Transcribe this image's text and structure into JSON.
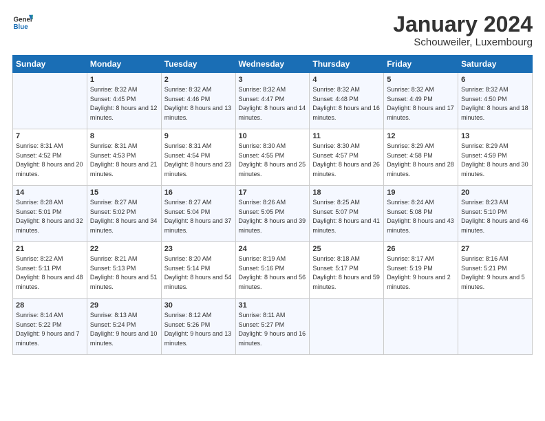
{
  "header": {
    "logo_general": "General",
    "logo_blue": "Blue",
    "month_title": "January 2024",
    "location": "Schouweiler, Luxembourg"
  },
  "calendar": {
    "days_of_week": [
      "Sunday",
      "Monday",
      "Tuesday",
      "Wednesday",
      "Thursday",
      "Friday",
      "Saturday"
    ],
    "weeks": [
      [
        {
          "day": "",
          "sunrise": "",
          "sunset": "",
          "daylight": ""
        },
        {
          "day": "1",
          "sunrise": "Sunrise: 8:32 AM",
          "sunset": "Sunset: 4:45 PM",
          "daylight": "Daylight: 8 hours and 12 minutes."
        },
        {
          "day": "2",
          "sunrise": "Sunrise: 8:32 AM",
          "sunset": "Sunset: 4:46 PM",
          "daylight": "Daylight: 8 hours and 13 minutes."
        },
        {
          "day": "3",
          "sunrise": "Sunrise: 8:32 AM",
          "sunset": "Sunset: 4:47 PM",
          "daylight": "Daylight: 8 hours and 14 minutes."
        },
        {
          "day": "4",
          "sunrise": "Sunrise: 8:32 AM",
          "sunset": "Sunset: 4:48 PM",
          "daylight": "Daylight: 8 hours and 16 minutes."
        },
        {
          "day": "5",
          "sunrise": "Sunrise: 8:32 AM",
          "sunset": "Sunset: 4:49 PM",
          "daylight": "Daylight: 8 hours and 17 minutes."
        },
        {
          "day": "6",
          "sunrise": "Sunrise: 8:32 AM",
          "sunset": "Sunset: 4:50 PM",
          "daylight": "Daylight: 8 hours and 18 minutes."
        }
      ],
      [
        {
          "day": "7",
          "sunrise": "Sunrise: 8:31 AM",
          "sunset": "Sunset: 4:52 PM",
          "daylight": "Daylight: 8 hours and 20 minutes."
        },
        {
          "day": "8",
          "sunrise": "Sunrise: 8:31 AM",
          "sunset": "Sunset: 4:53 PM",
          "daylight": "Daylight: 8 hours and 21 minutes."
        },
        {
          "day": "9",
          "sunrise": "Sunrise: 8:31 AM",
          "sunset": "Sunset: 4:54 PM",
          "daylight": "Daylight: 8 hours and 23 minutes."
        },
        {
          "day": "10",
          "sunrise": "Sunrise: 8:30 AM",
          "sunset": "Sunset: 4:55 PM",
          "daylight": "Daylight: 8 hours and 25 minutes."
        },
        {
          "day": "11",
          "sunrise": "Sunrise: 8:30 AM",
          "sunset": "Sunset: 4:57 PM",
          "daylight": "Daylight: 8 hours and 26 minutes."
        },
        {
          "day": "12",
          "sunrise": "Sunrise: 8:29 AM",
          "sunset": "Sunset: 4:58 PM",
          "daylight": "Daylight: 8 hours and 28 minutes."
        },
        {
          "day": "13",
          "sunrise": "Sunrise: 8:29 AM",
          "sunset": "Sunset: 4:59 PM",
          "daylight": "Daylight: 8 hours and 30 minutes."
        }
      ],
      [
        {
          "day": "14",
          "sunrise": "Sunrise: 8:28 AM",
          "sunset": "Sunset: 5:01 PM",
          "daylight": "Daylight: 8 hours and 32 minutes."
        },
        {
          "day": "15",
          "sunrise": "Sunrise: 8:27 AM",
          "sunset": "Sunset: 5:02 PM",
          "daylight": "Daylight: 8 hours and 34 minutes."
        },
        {
          "day": "16",
          "sunrise": "Sunrise: 8:27 AM",
          "sunset": "Sunset: 5:04 PM",
          "daylight": "Daylight: 8 hours and 37 minutes."
        },
        {
          "day": "17",
          "sunrise": "Sunrise: 8:26 AM",
          "sunset": "Sunset: 5:05 PM",
          "daylight": "Daylight: 8 hours and 39 minutes."
        },
        {
          "day": "18",
          "sunrise": "Sunrise: 8:25 AM",
          "sunset": "Sunset: 5:07 PM",
          "daylight": "Daylight: 8 hours and 41 minutes."
        },
        {
          "day": "19",
          "sunrise": "Sunrise: 8:24 AM",
          "sunset": "Sunset: 5:08 PM",
          "daylight": "Daylight: 8 hours and 43 minutes."
        },
        {
          "day": "20",
          "sunrise": "Sunrise: 8:23 AM",
          "sunset": "Sunset: 5:10 PM",
          "daylight": "Daylight: 8 hours and 46 minutes."
        }
      ],
      [
        {
          "day": "21",
          "sunrise": "Sunrise: 8:22 AM",
          "sunset": "Sunset: 5:11 PM",
          "daylight": "Daylight: 8 hours and 48 minutes."
        },
        {
          "day": "22",
          "sunrise": "Sunrise: 8:21 AM",
          "sunset": "Sunset: 5:13 PM",
          "daylight": "Daylight: 8 hours and 51 minutes."
        },
        {
          "day": "23",
          "sunrise": "Sunrise: 8:20 AM",
          "sunset": "Sunset: 5:14 PM",
          "daylight": "Daylight: 8 hours and 54 minutes."
        },
        {
          "day": "24",
          "sunrise": "Sunrise: 8:19 AM",
          "sunset": "Sunset: 5:16 PM",
          "daylight": "Daylight: 8 hours and 56 minutes."
        },
        {
          "day": "25",
          "sunrise": "Sunrise: 8:18 AM",
          "sunset": "Sunset: 5:17 PM",
          "daylight": "Daylight: 8 hours and 59 minutes."
        },
        {
          "day": "26",
          "sunrise": "Sunrise: 8:17 AM",
          "sunset": "Sunset: 5:19 PM",
          "daylight": "Daylight: 9 hours and 2 minutes."
        },
        {
          "day": "27",
          "sunrise": "Sunrise: 8:16 AM",
          "sunset": "Sunset: 5:21 PM",
          "daylight": "Daylight: 9 hours and 5 minutes."
        }
      ],
      [
        {
          "day": "28",
          "sunrise": "Sunrise: 8:14 AM",
          "sunset": "Sunset: 5:22 PM",
          "daylight": "Daylight: 9 hours and 7 minutes."
        },
        {
          "day": "29",
          "sunrise": "Sunrise: 8:13 AM",
          "sunset": "Sunset: 5:24 PM",
          "daylight": "Daylight: 9 hours and 10 minutes."
        },
        {
          "day": "30",
          "sunrise": "Sunrise: 8:12 AM",
          "sunset": "Sunset: 5:26 PM",
          "daylight": "Daylight: 9 hours and 13 minutes."
        },
        {
          "day": "31",
          "sunrise": "Sunrise: 8:11 AM",
          "sunset": "Sunset: 5:27 PM",
          "daylight": "Daylight: 9 hours and 16 minutes."
        },
        {
          "day": "",
          "sunrise": "",
          "sunset": "",
          "daylight": ""
        },
        {
          "day": "",
          "sunrise": "",
          "sunset": "",
          "daylight": ""
        },
        {
          "day": "",
          "sunrise": "",
          "sunset": "",
          "daylight": ""
        }
      ]
    ]
  }
}
